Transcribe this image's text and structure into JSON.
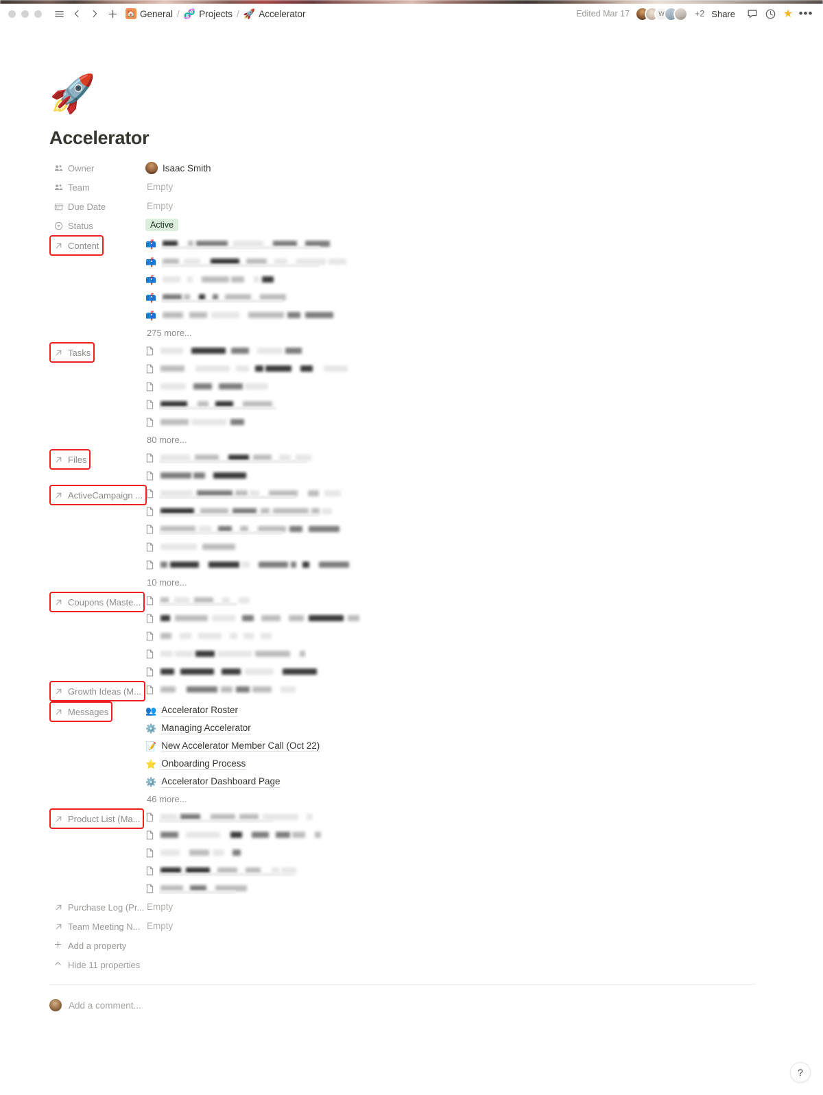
{
  "window": {
    "traffic_lights": [
      "close",
      "minimize",
      "zoom"
    ],
    "sidebar_toggle_icon": "hamburger-icon",
    "back_icon": "chevron-left-icon",
    "forward_icon": "chevron-right-icon",
    "new_page_icon": "plus-icon"
  },
  "breadcrumb": {
    "home_emoji": "🏠",
    "items": [
      {
        "label": "General",
        "emoji": ""
      },
      {
        "label": "Projects",
        "emoji": "🧬"
      },
      {
        "label": "Accelerator",
        "emoji": "🚀"
      }
    ],
    "separator": "/"
  },
  "header": {
    "edited": "Edited Mar 17",
    "avatar_initial": "W",
    "overflow_count": "+2",
    "share_label": "Share",
    "comment_icon": "comment-icon",
    "history_icon": "clock-icon",
    "favorite_icon": "star-icon",
    "more_icon": "ellipsis-icon"
  },
  "page": {
    "emoji": "🚀",
    "title": "Accelerator"
  },
  "properties": [
    {
      "name": "Owner",
      "icon": "person-icon",
      "highlighted": false,
      "value_type": "person",
      "person": "Isaac Smith"
    },
    {
      "name": "Team",
      "icon": "person-icon",
      "highlighted": false,
      "value_type": "empty",
      "empty_label": "Empty"
    },
    {
      "name": "Due Date",
      "icon": "calendar-icon",
      "highlighted": false,
      "value_type": "empty",
      "empty_label": "Empty"
    },
    {
      "name": "Status",
      "icon": "status-circle-icon",
      "highlighted": false,
      "value_type": "select",
      "badge": "Active",
      "badge_bg": "#dbeddb",
      "badge_fg": "#1c3829"
    },
    {
      "name": "Content",
      "icon": "relation-arrow-icon",
      "highlighted": true,
      "value_type": "relation",
      "item_emoji": "📫",
      "redacted_rows": 5,
      "more_label": "275 more..."
    },
    {
      "name": "Tasks",
      "icon": "relation-arrow-icon",
      "highlighted": true,
      "value_type": "relation",
      "item_emoji": "doc",
      "redacted_rows": 5,
      "more_label": "80 more..."
    },
    {
      "name": "Files",
      "icon": "relation-arrow-icon",
      "highlighted": true,
      "value_type": "relation",
      "item_emoji": "doc",
      "redacted_rows": 2,
      "more_label": ""
    },
    {
      "name": "ActiveCampaign ...",
      "icon": "relation-arrow-icon",
      "highlighted": true,
      "value_type": "relation",
      "item_emoji": "doc",
      "redacted_rows": 5,
      "more_label": "10 more..."
    },
    {
      "name": "Coupons (Maste...",
      "icon": "relation-arrow-icon",
      "highlighted": true,
      "value_type": "relation",
      "item_emoji": "doc",
      "redacted_rows": 5,
      "more_label": ""
    },
    {
      "name": "Growth Ideas (M...",
      "icon": "relation-arrow-icon",
      "highlighted": true,
      "value_type": "relation",
      "item_emoji": "doc",
      "redacted_rows": 1,
      "more_label": ""
    },
    {
      "name": "Messages",
      "icon": "relation-arrow-icon",
      "highlighted": true,
      "value_type": "relation_visible",
      "items": [
        {
          "emoji": "👥",
          "label": "Accelerator Roster"
        },
        {
          "emoji": "⚙️",
          "label": "Managing Accelerator"
        },
        {
          "emoji": "📝",
          "label": "New Accelerator Member Call (Oct 22)"
        },
        {
          "emoji": "⭐",
          "label": "Onboarding Process"
        },
        {
          "emoji": "⚙️",
          "label": "Accelerator Dashboard Page"
        }
      ],
      "more_label": "46 more..."
    },
    {
      "name": "Product List (Ma...",
      "icon": "relation-arrow-icon",
      "highlighted": true,
      "value_type": "relation",
      "item_emoji": "doc",
      "redacted_rows": 5,
      "more_label": ""
    },
    {
      "name": "Purchase Log (Pr...",
      "icon": "relation-arrow-icon",
      "highlighted": false,
      "value_type": "empty",
      "empty_label": "Empty"
    },
    {
      "name": "Team Meeting N...",
      "icon": "relation-arrow-icon",
      "highlighted": false,
      "value_type": "empty",
      "empty_label": "Empty"
    }
  ],
  "footer": {
    "add_property_label": "Add a property",
    "hide_properties_label": "Hide 11 properties",
    "comment_placeholder": "Add a comment...",
    "help_label": "?"
  },
  "colors": {
    "highlight_box": "#f01f1f",
    "accent_green_bg": "#dbeddb",
    "text_primary": "#37352f",
    "text_muted": "#9b9a97"
  }
}
